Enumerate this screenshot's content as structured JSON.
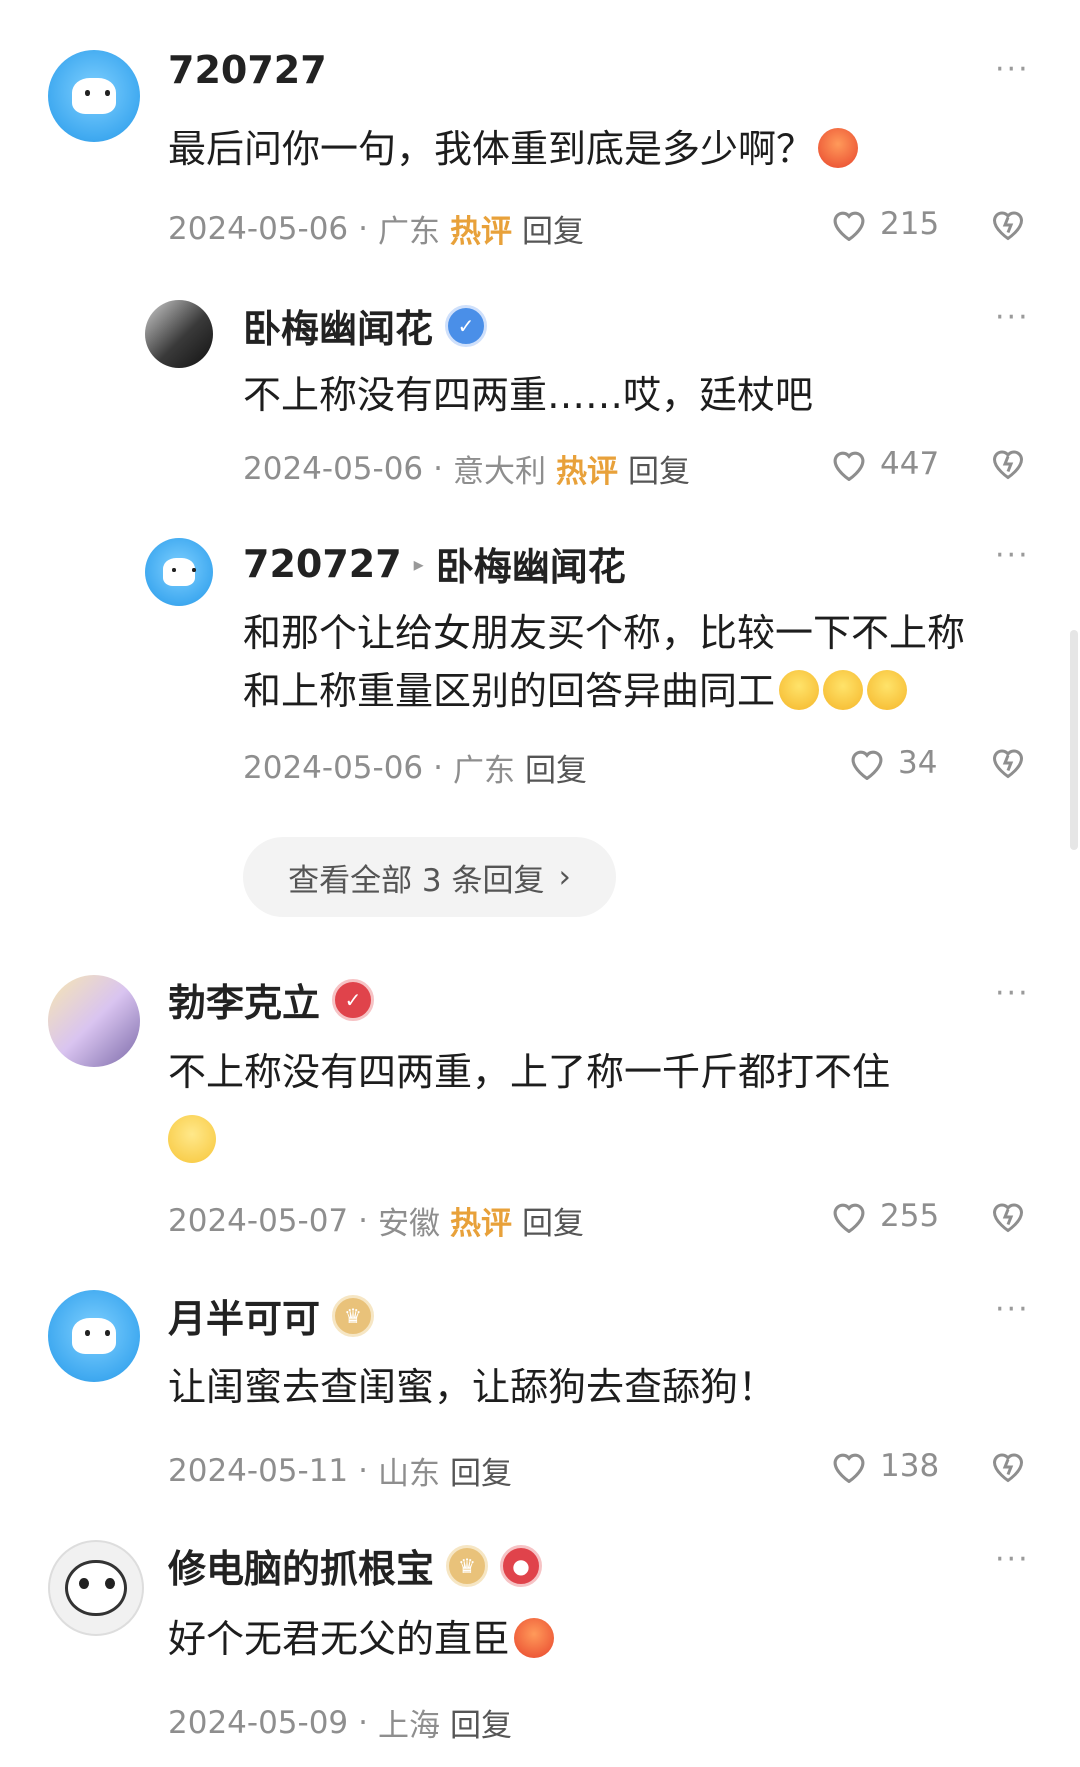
{
  "comments": [
    {
      "id": "c1",
      "user": "720727",
      "text": "最后问你一句，我体重到底是多少啊？",
      "emoji": "angry",
      "date": "2024-05-06",
      "location": "广东",
      "hot_label": "热评",
      "reply_label": "回复",
      "likes": "215"
    },
    {
      "id": "c1r1",
      "user": "卧梅幽闻花",
      "text": "不上称没有四两重……哎，廷杖吧",
      "date": "2024-05-06",
      "location": "意大利",
      "hot_label": "热评",
      "reply_label": "回复",
      "likes": "447"
    },
    {
      "id": "c1r2",
      "user": "720727",
      "reply_to": "卧梅幽闻花",
      "text_line1": "和那个让给女朋友买个称，比较一下不上称",
      "text_line2": "和上称重量区别的回答异曲同工",
      "date": "2024-05-06",
      "location": "广东",
      "reply_label": "回复",
      "likes": "34"
    },
    {
      "id": "c2",
      "user": "勃李克立",
      "text": "不上称没有四两重，上了称一千斤都打不住",
      "date": "2024-05-07",
      "location": "安徽",
      "hot_label": "热评",
      "reply_label": "回复",
      "likes": "255"
    },
    {
      "id": "c3",
      "user": "月半可可",
      "text": "让闺蜜去查闺蜜，让舔狗去查舔狗！",
      "date": "2024-05-11",
      "location": "山东",
      "reply_label": "回复",
      "likes": "138"
    },
    {
      "id": "c4",
      "user": "修电脑的抓根宝",
      "text": "好个无君无父的直臣",
      "date": "2024-05-09",
      "location": "上海",
      "reply_label": "回复"
    }
  ],
  "view_all_replies": "查看全部 3 条回复",
  "menu_glyph": "···",
  "separator": "·",
  "colors": {
    "hot": "#e8a13a",
    "meta": "#8e8e8e",
    "accent_blue": "#4a8fe8"
  }
}
